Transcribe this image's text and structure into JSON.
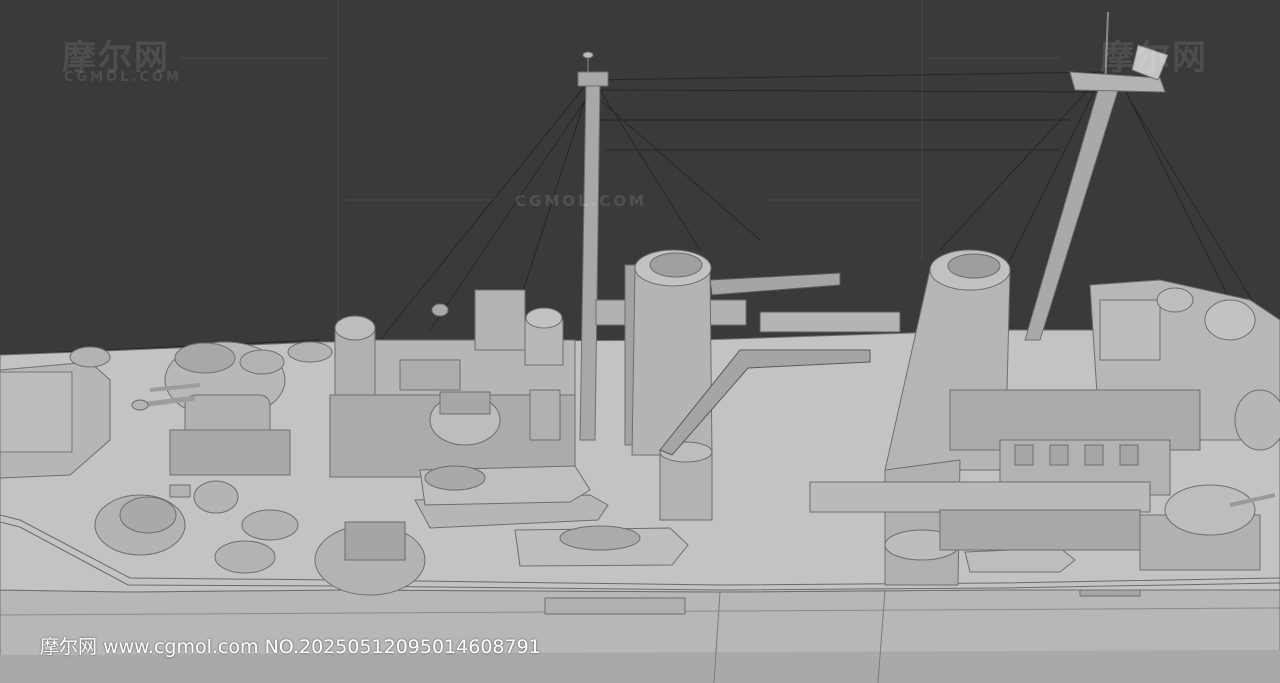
{
  "watermark": {
    "brand_cn": "摩尔网",
    "brand_en": "CGMOL.COM",
    "center_text": "CGMOL.COM"
  },
  "caption": {
    "site_name": "摩尔网",
    "url": "www.cgmol.com",
    "number": "NO.2025051209501460​8791"
  },
  "colors": {
    "background": "#3a3a3a",
    "hull": "#b9b9b9",
    "deck": "#c4c4c4",
    "structure": "#b3b3b3",
    "shadow": "#8e8e8e",
    "edge": "#6e6e6e",
    "wire": "#2a2a2a"
  }
}
